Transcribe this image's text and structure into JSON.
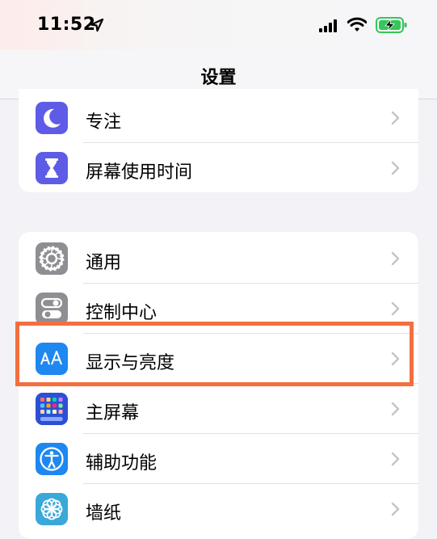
{
  "status_bar": {
    "time": "11:52",
    "location_icon": "location-arrow-icon",
    "signal_icon": "cellular-signal-icon",
    "wifi_icon": "wifi-icon",
    "battery_icon": "battery-charging-icon",
    "battery_color": "#34c759"
  },
  "nav": {
    "title": "设置"
  },
  "group1": {
    "items": [
      {
        "label": "专注",
        "icon": "moon-icon",
        "color": "#5e5ce6"
      },
      {
        "label": "屏幕使用时间",
        "icon": "hourglass-icon",
        "color": "#5e5ce6"
      }
    ]
  },
  "group2": {
    "items": [
      {
        "label": "通用",
        "icon": "gear-icon",
        "color": "#8e8e93"
      },
      {
        "label": "控制中心",
        "icon": "toggles-icon",
        "color": "#8e8e93"
      },
      {
        "label": "显示与亮度",
        "icon": "text-size-icon",
        "color": "#1e88f0"
      },
      {
        "label": "主屏幕",
        "icon": "home-screen-grid-icon",
        "color": "#2c4fd6"
      },
      {
        "label": "辅助功能",
        "icon": "accessibility-icon",
        "color": "#1e88f0"
      },
      {
        "label": "墙纸",
        "icon": "wallpaper-flower-icon",
        "color": "#3aa8d8"
      }
    ]
  },
  "highlight_color": "#f36f3f"
}
